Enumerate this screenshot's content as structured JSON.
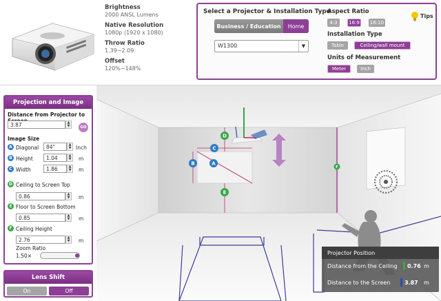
{
  "specs": {
    "brightness_label": "Brightness",
    "brightness_value": "2000 ANSL Lumens",
    "resolution_label": "Native Resolution",
    "resolution_value": "1080p (1920 x 1080)",
    "throw_label": "Throw Ratio",
    "throw_value": "1.39~2.09",
    "offset_label": "Offset",
    "offset_value": "120%~148%"
  },
  "selector": {
    "title": "Select a Projector & Installation Type",
    "tabs": [
      "Business / Education",
      "Home"
    ],
    "active_tab": "Home",
    "model": "W1300"
  },
  "aspect": {
    "title": "Aspect Ratio",
    "options": [
      "4:3",
      "16:9",
      "16:10"
    ],
    "selected": "16:9"
  },
  "installation": {
    "title": "Installation Type",
    "options": [
      "Table",
      "Ceiling/wall mount"
    ],
    "selected": "Ceiling/wall mount"
  },
  "units": {
    "title": "Units of Measurement",
    "options": [
      "Meter",
      "Inch"
    ],
    "selected": "Meter"
  },
  "tips_label": "Tips",
  "panel": {
    "title": "Projection and Image",
    "distance_label": "Distance from Projector to Screen",
    "distance_value": "3.87",
    "go_label": "GO",
    "image_size_label": "Image Size",
    "diagonal_label": "Diagonal",
    "diagonal_value": "84\"",
    "diagonal_unit": "Inch",
    "height_label": "Height",
    "height_value": "1.04",
    "height_unit": "m",
    "width_label": "Width",
    "width_value": "1.86",
    "width_unit": "m",
    "ceiling_top_label": "Ceiling to Screen Top",
    "ceiling_top_value": "0.86",
    "ceiling_top_unit": "m",
    "floor_bottom_label": "Floor to Screen Bottom",
    "floor_bottom_value": "0.85",
    "floor_bottom_unit": "m",
    "ceiling_height_label": "Ceiling Height",
    "ceiling_height_value": "2.76",
    "ceiling_height_unit": "m",
    "zoom_label": "Zoom Ratio",
    "zoom_value": "1.50×",
    "zoom_level": 1.0
  },
  "lens": {
    "title": "Lens Shift",
    "on_label": "On",
    "off_label": "Off",
    "selected": "Off"
  },
  "position": {
    "title": "Projector Position",
    "ceiling_label": "Distance from the Ceiling",
    "ceiling_value": "0.76",
    "ceiling_unit": "m",
    "screen_label": "Distance to the Screen",
    "screen_value": "3.87",
    "screen_unit": "m"
  },
  "badges": {
    "a": "A",
    "b": "B",
    "c": "C",
    "d": "D",
    "e": "E",
    "f": "F"
  },
  "colors": {
    "accent": "#8d3f95",
    "badge_blue": "#2d7cc4",
    "badge_green": "#3aa84a"
  }
}
